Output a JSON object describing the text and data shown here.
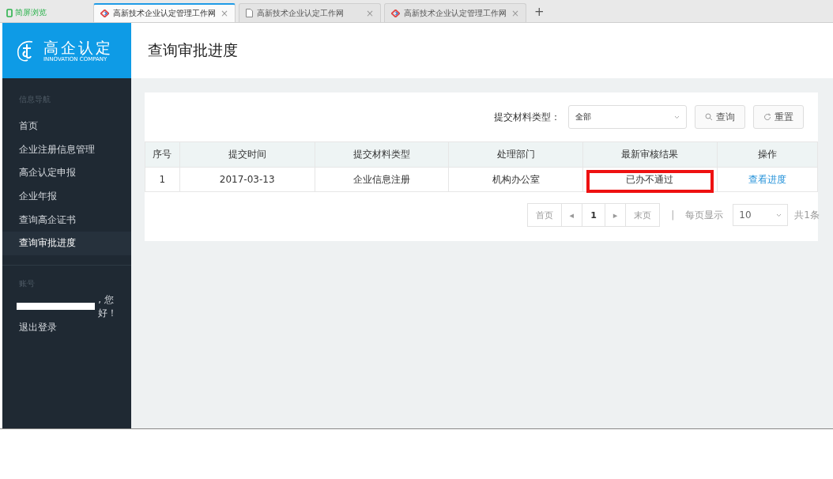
{
  "browser": {
    "brand": "简屏浏览",
    "tabs": [
      {
        "title": "高新技术企业认定管理工作网",
        "kind": "site",
        "close": "×",
        "selected": true
      },
      {
        "title": "高新技术企业认定工作网",
        "kind": "page",
        "close": "×",
        "selected": false
      },
      {
        "title": "高新技术企业认定管理工作网",
        "kind": "site",
        "close": "×",
        "selected": false
      }
    ],
    "new_tab": "+"
  },
  "logo": {
    "title": "高企认定",
    "subtitle": "INNOVATION COMPANY"
  },
  "sidebar": {
    "section": "信息导航",
    "items": [
      {
        "label": "首页",
        "selected": false
      },
      {
        "label": "企业注册信息管理",
        "selected": false
      },
      {
        "label": "高企认定申报",
        "selected": false
      },
      {
        "label": "企业年报",
        "selected": false
      },
      {
        "label": "查询高企证书",
        "selected": false
      },
      {
        "label": "查询审批进度",
        "selected": true
      }
    ],
    "account_heading": "账号",
    "greeting": ", 您好！",
    "logout": "退出登录"
  },
  "page_title": "查询审批进度",
  "filter": {
    "label": "提交材料类型：",
    "value": "全部",
    "search_button": "查询",
    "reset_button": "重置"
  },
  "table": {
    "columns": [
      "序号",
      "提交时间",
      "提交材料类型",
      "处理部门",
      "最新审核结果",
      "操作"
    ],
    "rows": [
      {
        "cells": [
          "1",
          "2017-03-13",
          "企业信息注册",
          "机构办公室",
          "已办不通过"
        ],
        "action": "查看进度",
        "highlighted": true
      }
    ]
  },
  "pagination": {
    "first": "首页",
    "prev": "◂",
    "current": "1",
    "next": "▸",
    "last": "末页",
    "separator": "|",
    "per_page_label": "每页显示",
    "per_page": "10",
    "total": "共1条"
  }
}
